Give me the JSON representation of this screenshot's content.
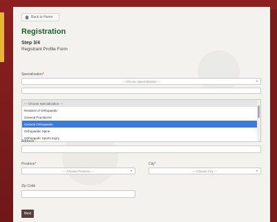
{
  "nav": {
    "back_label": "Back to Home"
  },
  "page": {
    "title": "Registration",
    "step": "Step 3/4",
    "subtitle": "Registrant Profile Form"
  },
  "form": {
    "specialization": {
      "label": "Specialization",
      "required_mark": "*",
      "placeholder": "--- Choose Specialization ---",
      "options": [
        "--- Choose Specialization ---",
        "Resident of Orthopaedic",
        "General Practitioner",
        "General Orthopaedic",
        "Orthopaedic Spine",
        "Orthopaedic Sports Injury"
      ],
      "highlighted_option": "General Orthopaedic"
    },
    "address": {
      "label": "Address",
      "required_mark": "*",
      "value": ""
    },
    "province": {
      "label": "Province",
      "required_mark": "*",
      "placeholder": "--- Choose Province ---"
    },
    "city": {
      "label": "City",
      "required_mark": "*",
      "placeholder": "--- Choose City ---"
    },
    "zip": {
      "label": "Zip Code",
      "value": ""
    },
    "next_label": "Next"
  },
  "colors": {
    "background": "#7a1a1a",
    "accent": "#e9b53b",
    "title": "#1f5d2c",
    "highlight": "#3c79d8",
    "button": "#5a3d3d"
  }
}
